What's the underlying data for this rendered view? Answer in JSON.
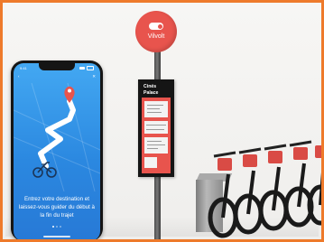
{
  "phone": {
    "status_time": "9:41",
    "nav_left": "‹",
    "nav_right": "✕",
    "message": "Entrez votre destination et laissez-vous guider du début à la fin du trajet",
    "page_dots": 3,
    "active_dot": 0
  },
  "station": {
    "brand": "Vilvolt",
    "sign_title": "Cinés Palace"
  },
  "icons": {
    "brand_logo": "toggle-logo-icon",
    "destination": "map-pin-icon",
    "bike": "bicycle-icon"
  },
  "colors": {
    "frame_border": "#ee7a2b",
    "brand_red": "#e8544d",
    "app_blue": "#2b88e0",
    "pole_grey": "#5a5a5a"
  }
}
